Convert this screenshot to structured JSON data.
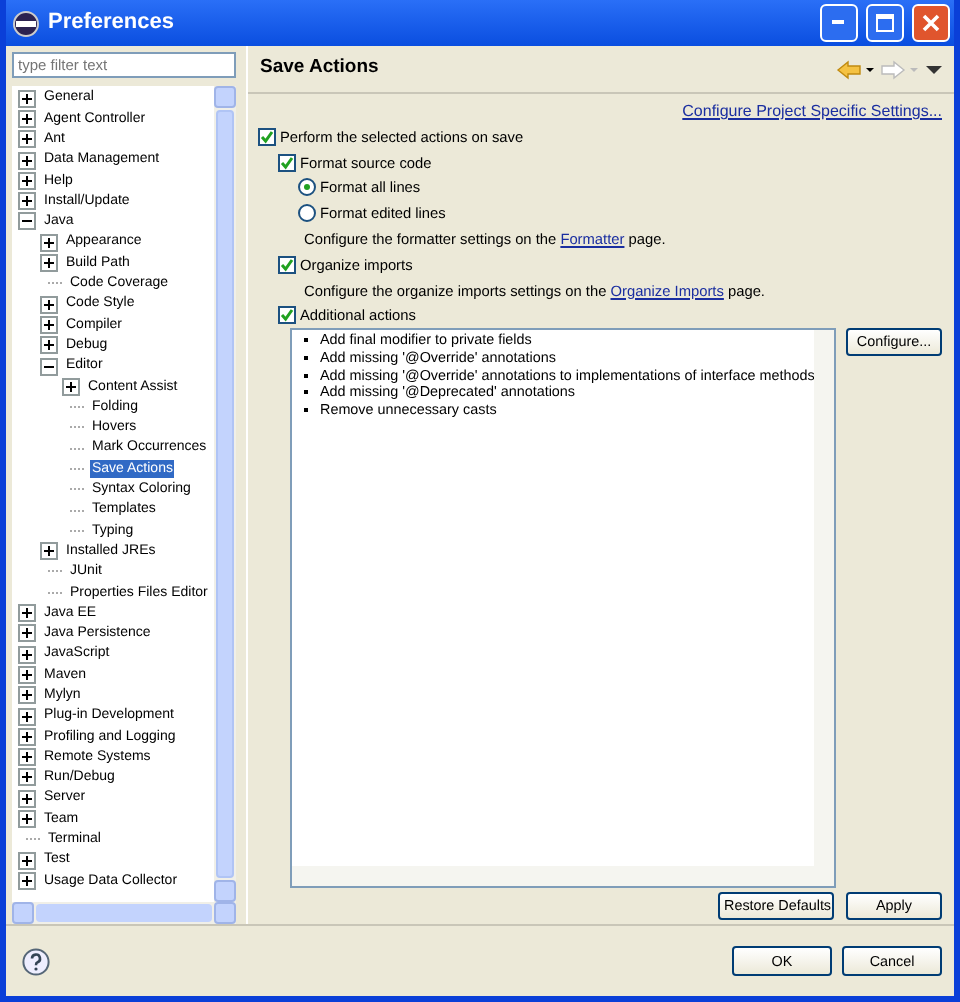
{
  "window": {
    "title": "Preferences"
  },
  "filter": {
    "placeholder": "type filter text"
  },
  "tree": [
    {
      "label": "General",
      "expanded": false,
      "selected": false
    },
    {
      "label": "Agent Controller",
      "expanded": false,
      "selected": false
    },
    {
      "label": "Ant",
      "expanded": false,
      "selected": false
    },
    {
      "label": "Data Management",
      "expanded": false,
      "selected": false
    },
    {
      "label": "Help",
      "expanded": false,
      "selected": false
    },
    {
      "label": "Install/Update",
      "expanded": false,
      "selected": false
    },
    {
      "label": "Java",
      "expanded": true,
      "selected": false,
      "children": [
        {
          "label": "Appearance",
          "expanded": false,
          "selected": false
        },
        {
          "label": "Build Path",
          "expanded": false,
          "selected": false
        },
        {
          "label": "Code Coverage",
          "selected": false
        },
        {
          "label": "Code Style",
          "expanded": false,
          "selected": false
        },
        {
          "label": "Compiler",
          "expanded": false,
          "selected": false
        },
        {
          "label": "Debug",
          "expanded": false,
          "selected": false
        },
        {
          "label": "Editor",
          "expanded": true,
          "selected": false,
          "children": [
            {
              "label": "Content Assist",
              "expanded": false,
              "selected": false
            },
            {
              "label": "Folding",
              "selected": false
            },
            {
              "label": "Hovers",
              "selected": false
            },
            {
              "label": "Mark Occurrences",
              "selected": false
            },
            {
              "label": "Save Actions",
              "selected": true
            },
            {
              "label": "Syntax Coloring",
              "selected": false
            },
            {
              "label": "Templates",
              "selected": false
            },
            {
              "label": "Typing",
              "selected": false
            }
          ]
        },
        {
          "label": "Installed JREs",
          "expanded": false,
          "selected": false
        },
        {
          "label": "JUnit",
          "selected": false
        },
        {
          "label": "Properties Files Editor",
          "selected": false
        }
      ]
    },
    {
      "label": "Java EE",
      "expanded": false,
      "selected": false
    },
    {
      "label": "Java Persistence",
      "expanded": false,
      "selected": false
    },
    {
      "label": "JavaScript",
      "expanded": false,
      "selected": false
    },
    {
      "label": "Maven",
      "expanded": false,
      "selected": false
    },
    {
      "label": "Mylyn",
      "expanded": false,
      "selected": false
    },
    {
      "label": "Plug-in Development",
      "expanded": false,
      "selected": false
    },
    {
      "label": "Profiling and Logging",
      "expanded": false,
      "selected": false
    },
    {
      "label": "Remote Systems",
      "expanded": false,
      "selected": false
    },
    {
      "label": "Run/Debug",
      "expanded": false,
      "selected": false
    },
    {
      "label": "Server",
      "expanded": false,
      "selected": false
    },
    {
      "label": "Team",
      "expanded": false,
      "selected": false
    },
    {
      "label": "Terminal",
      "selected": false
    },
    {
      "label": "Test",
      "expanded": false,
      "selected": false
    },
    {
      "label": "Usage Data Collector",
      "expanded": false,
      "selected": false
    }
  ],
  "page": {
    "title": "Save Actions",
    "project_link": "Configure Project Specific Settings...",
    "options": [
      {
        "kind": "checkbox",
        "label": "Perform the selected actions on save",
        "checked": true,
        "children": [
          {
            "kind": "checkbox",
            "label": "Format source code",
            "checked": true,
            "children": [
              {
                "kind": "radio",
                "label": "Format all lines",
                "checked": true
              },
              {
                "kind": "radio",
                "label": "Format edited lines",
                "checked": false
              },
              {
                "kind": "note",
                "label": "Configure the formatter settings on the ",
                "link": "Formatter",
                "after": " page."
              }
            ]
          },
          {
            "kind": "checkbox",
            "label": "Organize imports",
            "checked": true,
            "children": [
              {
                "kind": "note",
                "label": "Configure the organize imports settings on the ",
                "link": "Organize Imports",
                "after": " page."
              }
            ]
          },
          {
            "kind": "checkbox",
            "label": "Additional actions",
            "checked": true
          }
        ]
      }
    ],
    "actions": [
      "Add final modifier to private fields",
      "Add missing '@Override' annotations",
      "Add missing '@Override' annotations to implementations of interface methods",
      "Add missing '@Deprecated' annotations",
      "Remove unnecessary casts"
    ],
    "configure_button": "Configure...",
    "restore_button": "Restore Defaults",
    "apply_button": "Apply"
  },
  "buttons": [
    "OK",
    "Cancel"
  ]
}
